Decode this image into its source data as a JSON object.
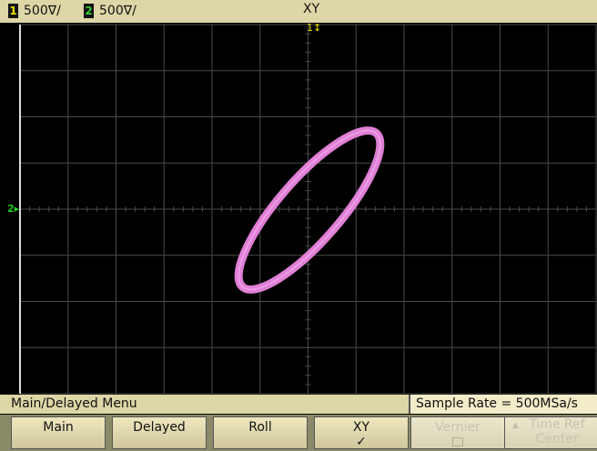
{
  "status_bar": {
    "ch1_badge": "1",
    "ch1_scale": "500∇/",
    "ch2_badge": "2",
    "ch2_scale": "500∇/",
    "mode": "XY"
  },
  "markers": {
    "trigger": "1↕",
    "ch2_ground": "2▸"
  },
  "menu": {
    "title": "Main/Delayed Menu",
    "sample_rate": "Sample Rate = 500MSa/s",
    "softkeys": [
      {
        "label": "Main",
        "enabled": true
      },
      {
        "label": "Delayed",
        "enabled": true
      },
      {
        "label": "Roll",
        "enabled": true
      },
      {
        "label": "XY",
        "enabled": true,
        "checked": true,
        "check_mark": "✓"
      },
      {
        "label": "Vernier",
        "enabled": false
      },
      {
        "label": "Time Ref",
        "sub": "Center",
        "enabled": false,
        "arrow": "▲"
      }
    ]
  },
  "colors": {
    "background": "#000000",
    "graticule": "#4a4a4a",
    "trace": "#e07fd6",
    "status_bar": "#ddd6a6",
    "ch1": "#e8e000",
    "ch2": "#33cc33"
  }
}
